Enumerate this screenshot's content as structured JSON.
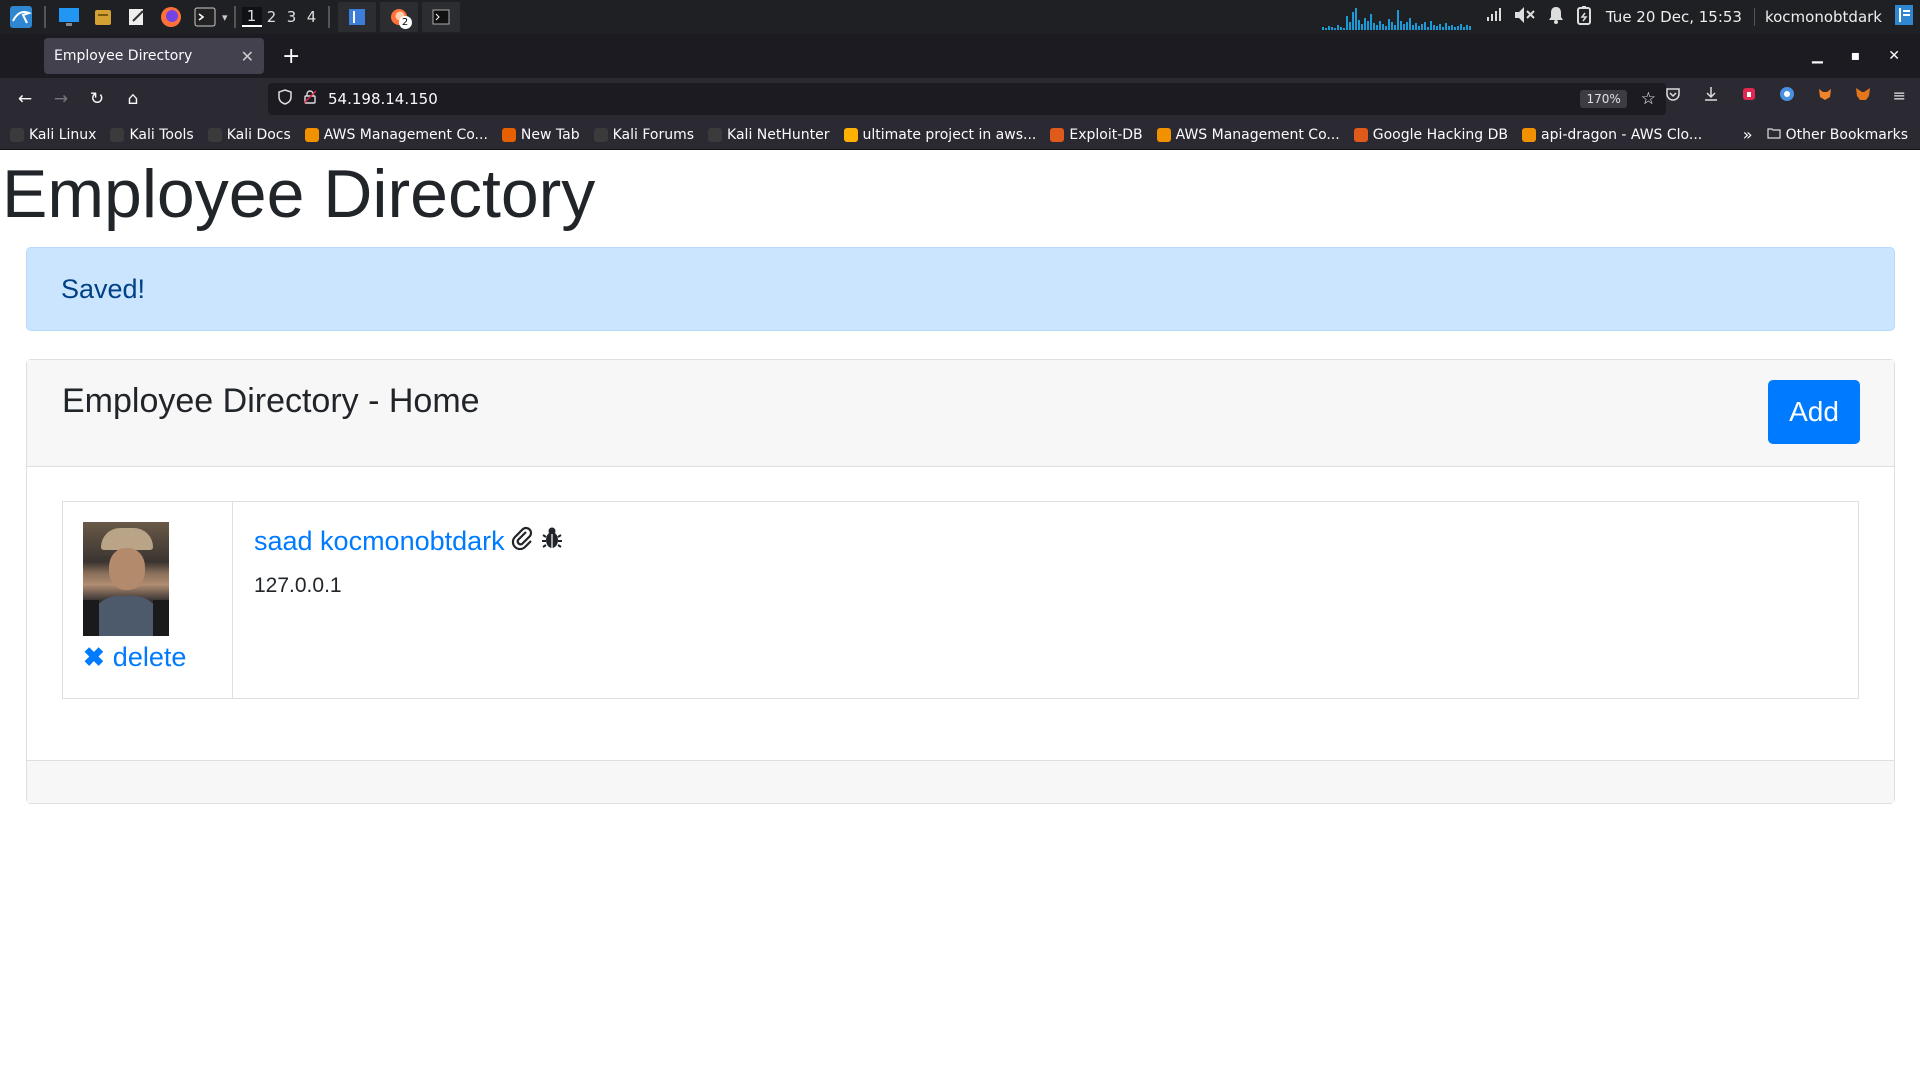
{
  "taskbar": {
    "workspaces": [
      "1",
      "2",
      "3",
      "4"
    ],
    "clock": "Tue 20 Dec, 15:53",
    "user": "kocmonobtdark",
    "window_badge": "2"
  },
  "browser": {
    "tab_title": "Employee Directory",
    "url": "54.198.14.150",
    "zoom": "170%",
    "bookmarks": [
      {
        "label": "Kali Linux",
        "color": "#3b3b3b"
      },
      {
        "label": "Kali Tools",
        "color": "#3b3b3b"
      },
      {
        "label": "Kali Docs",
        "color": "#3b3b3b"
      },
      {
        "label": "AWS Management Co...",
        "color": "#f29100"
      },
      {
        "label": "New Tab",
        "color": "#e66000"
      },
      {
        "label": "Kali Forums",
        "color": "#3b3b3b"
      },
      {
        "label": "Kali NetHunter",
        "color": "#3b3b3b"
      },
      {
        "label": "ultimate project in aws...",
        "color": "#ffb000"
      },
      {
        "label": "Exploit-DB",
        "color": "#e05a1b"
      },
      {
        "label": "AWS Management Co...",
        "color": "#f29100"
      },
      {
        "label": "Google Hacking DB",
        "color": "#e05a1b"
      },
      {
        "label": "api-dragon - AWS Clo...",
        "color": "#f29100"
      }
    ],
    "other_bookmarks": "Other Bookmarks"
  },
  "page": {
    "title": "Employee Directory",
    "alert": "Saved!",
    "card_title": "Employee Directory - Home",
    "add_label": "Add",
    "employees": [
      {
        "name": "saad kocmonobtdark",
        "location": "127.0.0.1",
        "delete_label": "delete"
      }
    ]
  },
  "colors": {
    "link": "#007bff",
    "alert_bg": "#cce5ff",
    "alert_text": "#004085",
    "button_bg": "#007bff"
  }
}
